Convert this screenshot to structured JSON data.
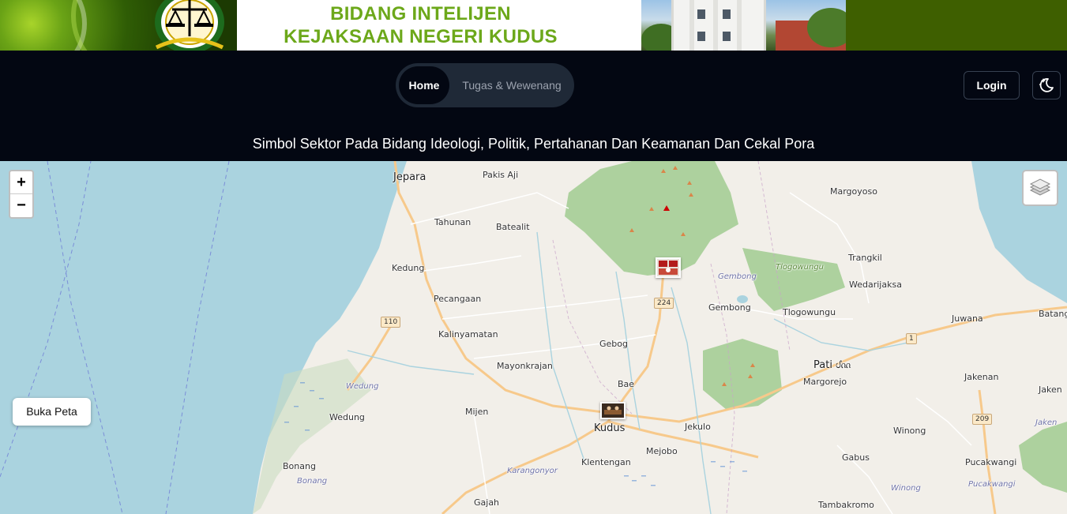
{
  "banner": {
    "title_line1": "BIDANG INTELIJEN",
    "title_line2": "KEJAKSAAN NEGERI KUDUS",
    "emblem_icon": "kejaksaan-scales-emblem"
  },
  "nav": {
    "tabs": [
      {
        "label": "Home",
        "active": true
      },
      {
        "label": "Tugas & Wewenang",
        "active": false
      }
    ],
    "login_label": "Login",
    "theme_icon": "moon-stars-icon"
  },
  "page": {
    "subtitle": "Simbol Sektor Pada Bidang Ideologi, Politik, Pertahanan Dan Keamanan Dan Cekal Pora"
  },
  "map": {
    "zoom_in_label": "+",
    "zoom_out_label": "−",
    "layers_icon": "layers-icon",
    "open_map_label": "Buka Peta",
    "places": [
      {
        "name": "Jepara",
        "kind": "town"
      },
      {
        "name": "Pakis Aji",
        "kind": "village"
      },
      {
        "name": "Margoyoso",
        "kind": "village"
      },
      {
        "name": "Tahunan",
        "kind": "village"
      },
      {
        "name": "Batealit",
        "kind": "village"
      },
      {
        "name": "Kedung",
        "kind": "village"
      },
      {
        "name": "Trangkil",
        "kind": "village"
      },
      {
        "name": "Wedarijaksa",
        "kind": "village"
      },
      {
        "name": "Pecangaan",
        "kind": "village"
      },
      {
        "name": "Gembong",
        "kind": "village"
      },
      {
        "name": "Tlogowungu",
        "kind": "village"
      },
      {
        "name": "Juwana",
        "kind": "village"
      },
      {
        "name": "Batang",
        "kind": "village"
      },
      {
        "name": "Kalinyamatan",
        "kind": "village"
      },
      {
        "name": "Gebog",
        "kind": "village"
      },
      {
        "name": "Mayonkrajan",
        "kind": "village"
      },
      {
        "name": "Pati ᦔᦶ",
        "kind": "town"
      },
      {
        "name": "Margorejo",
        "kind": "village"
      },
      {
        "name": "Jakenan",
        "kind": "village"
      },
      {
        "name": "Bae",
        "kind": "village"
      },
      {
        "name": "Jaken",
        "kind": "village"
      },
      {
        "name": "Mijen",
        "kind": "village"
      },
      {
        "name": "Wedung",
        "kind": "village"
      },
      {
        "name": "Kudus",
        "kind": "town"
      },
      {
        "name": "Jekulo",
        "kind": "village"
      },
      {
        "name": "Winong",
        "kind": "village"
      },
      {
        "name": "Klentengan",
        "kind": "village"
      },
      {
        "name": "Mejobo",
        "kind": "village"
      },
      {
        "name": "Gabus",
        "kind": "village"
      },
      {
        "name": "Bonang",
        "kind": "village"
      },
      {
        "name": "Pucakwangi",
        "kind": "village"
      },
      {
        "name": "Gajah",
        "kind": "village"
      },
      {
        "name": "Tambakromo",
        "kind": "village"
      }
    ],
    "area_labels": [
      "Tlogowungu",
      "Gembong",
      "Wedung",
      "Bonang",
      "Karangonyor",
      "Winong",
      "Pucakwangi",
      "Jaken"
    ],
    "road_shields": [
      "224",
      "110",
      "1",
      "209"
    ],
    "colors": {
      "sea": "#aad3df",
      "land": "#f2efe9",
      "forest": "#add19e",
      "road": "#f7c98b"
    }
  }
}
